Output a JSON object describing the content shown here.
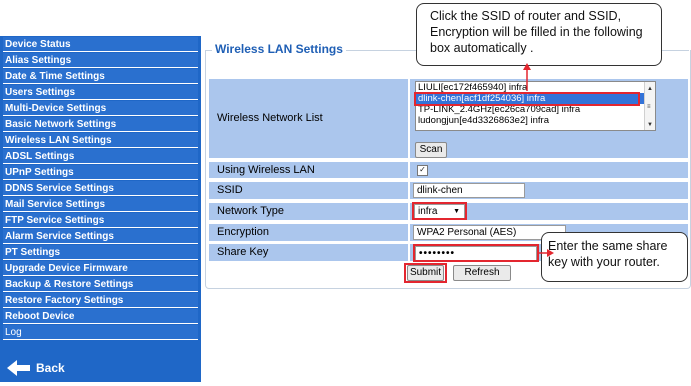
{
  "sidebar": {
    "items": [
      {
        "label": "Device Status"
      },
      {
        "label": "Alias Settings"
      },
      {
        "label": "Date & Time Settings"
      },
      {
        "label": "Users Settings"
      },
      {
        "label": "Multi-Device Settings"
      },
      {
        "label": "Basic Network Settings"
      },
      {
        "label": "Wireless LAN Settings"
      },
      {
        "label": "ADSL Settings"
      },
      {
        "label": "UPnP Settings"
      },
      {
        "label": "DDNS Service Settings"
      },
      {
        "label": "Mail Service Settings"
      },
      {
        "label": "FTP Service Settings"
      },
      {
        "label": "Alarm Service Settings"
      },
      {
        "label": "PT Settings"
      },
      {
        "label": "Upgrade Device Firmware"
      },
      {
        "label": "Backup & Restore Settings"
      },
      {
        "label": "Restore Factory Settings"
      },
      {
        "label": "Reboot Device"
      },
      {
        "label": "Log"
      }
    ],
    "back_label": "Back"
  },
  "panel": {
    "title": "Wireless LAN Settings",
    "wireless_network_list_label": "Wireless Network List",
    "networks": [
      "LIULI[ec172f465940] infra",
      "dlink-chen[acf1df254036] infra",
      "TP-LINK_2.4GHz[ec26ca709cad] infra",
      "ludongjun[e4d3326863e2] infra"
    ],
    "selected_network_index": 1,
    "scan_label": "Scan",
    "using_wlan_label": "Using Wireless LAN",
    "using_wlan_checked": true,
    "ssid_label": "SSID",
    "ssid_value": "dlink-chen",
    "network_type_label": "Network Type",
    "network_type_value": "infra",
    "encryption_label": "Encryption",
    "encryption_value": "WPA2 Personal (AES)",
    "share_key_label": "Share Key",
    "share_key_value": "••••••••",
    "submit_label": "Submit",
    "refresh_label": "Refresh"
  },
  "callouts": {
    "top": "Click the SSID of router and SSID, Encryption will be filled in the following box automatically .",
    "right": "Enter the same share key with your router."
  },
  "colors": {
    "sidebar_bg": "#1f67c7",
    "sidebar_item": "#2a70cf",
    "form_row_bg": "#abc6ed",
    "title_color": "#1f5fb5",
    "highlight_red": "#e3262f",
    "selected_row": "#3373d8"
  }
}
